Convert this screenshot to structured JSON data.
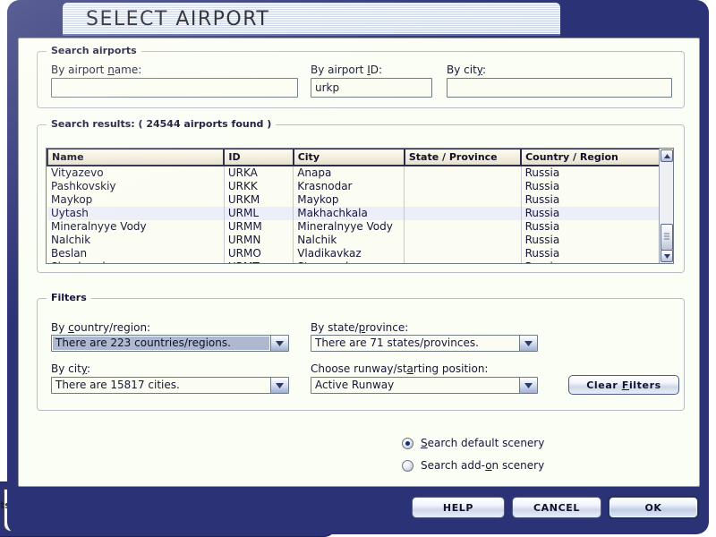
{
  "window": {
    "title": "SELECT AIRPORT",
    "background_window_text": "ts"
  },
  "search_group": {
    "legend": "Search airports",
    "fields": [
      {
        "label_pre": "By airport ",
        "label_key": "n",
        "label_post": "ame:",
        "value": "",
        "placeholder": ""
      },
      {
        "label_pre": "By airport ",
        "label_key": "I",
        "label_post": "D:",
        "value": "urkp",
        "placeholder": ""
      },
      {
        "label_pre": "By cit",
        "label_key": "y",
        "label_post": ":",
        "value": "",
        "placeholder": ""
      }
    ]
  },
  "results_group": {
    "legend": "Search results: ( 24544 airports found )",
    "count": 24544,
    "columns": [
      "Name",
      "ID",
      "City",
      "State / Province",
      "Country / Region"
    ],
    "rows": [
      {
        "name": "Vityazevo",
        "id": "URKA",
        "city": "Anapa",
        "state": "",
        "country": "Russia",
        "selected": false
      },
      {
        "name": "Pashkovskiy",
        "id": "URKK",
        "city": "Krasnodar",
        "state": "",
        "country": "Russia",
        "selected": false
      },
      {
        "name": "Maykop",
        "id": "URKM",
        "city": "Maykop",
        "state": "",
        "country": "Russia",
        "selected": false
      },
      {
        "name": "Uytash",
        "id": "URML",
        "city": "Makhachkala",
        "state": "",
        "country": "Russia",
        "selected": true
      },
      {
        "name": "Mineralnyye Vody",
        "id": "URMM",
        "city": "Mineralnyye Vody",
        "state": "",
        "country": "Russia",
        "selected": false
      },
      {
        "name": "Nalchik",
        "id": "URMN",
        "city": "Nalchik",
        "state": "",
        "country": "Russia",
        "selected": false
      },
      {
        "name": "Beslan",
        "id": "URMO",
        "city": "Vladikavkaz",
        "state": "",
        "country": "Russia",
        "selected": false
      },
      {
        "name": "Shpakovskoye",
        "id": "URMT",
        "city": "Stavropol",
        "state": "",
        "country": "Russia",
        "selected": false
      }
    ]
  },
  "filters_group": {
    "legend": "Filters",
    "country": {
      "label_pre": "By ",
      "label_key": "c",
      "label_post": "ountry/region:",
      "value": "There are 223 countries/regions."
    },
    "state": {
      "label_pre": "By state/",
      "label_key": "p",
      "label_post": "rovince:",
      "value": "There are 71 states/provinces."
    },
    "city": {
      "label_pre": "By cit",
      "label_key": "y",
      "label_post": ":",
      "value": "There are 15817 cities."
    },
    "runway": {
      "label_pre": "Choose runway/st",
      "label_key": "a",
      "label_post": "rting position:",
      "value": "Active Runway"
    },
    "clear_button": {
      "pre": "Clear ",
      "key": "F",
      "post": "ilters"
    }
  },
  "scenery": {
    "options": [
      {
        "label_pre": "",
        "label_key": "S",
        "label_post": "earch default scenery",
        "selected": true
      },
      {
        "label_pre": "Search add-",
        "label_key": "o",
        "label_post": "n scenery",
        "selected": false
      }
    ]
  },
  "footer": {
    "buttons": [
      {
        "label": "HELP",
        "primary": false
      },
      {
        "label": "CANCEL",
        "primary": false
      },
      {
        "label": "OK",
        "primary": true
      }
    ]
  },
  "colors": {
    "frame": "#2b3276",
    "client_bg": "#fbfef5",
    "selection": "#eceef9",
    "combo_selection": "#aeb8cf"
  }
}
